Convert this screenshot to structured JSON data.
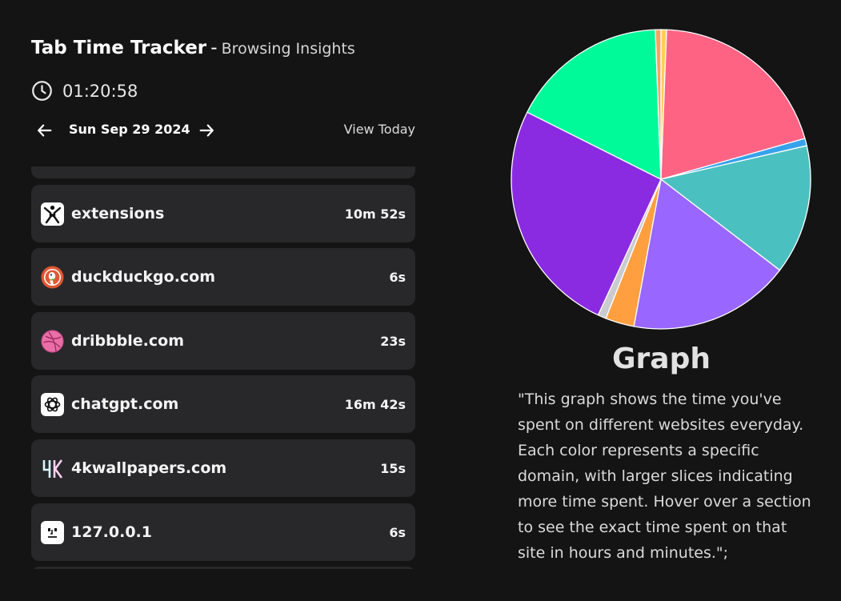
{
  "header": {
    "title": "Tab Time Tracker",
    "separator": "-",
    "subtitle": "Browsing Insights"
  },
  "timer": {
    "icon": "clock-icon",
    "value": "01:20:58"
  },
  "date_nav": {
    "prev_icon": "arrow-left-icon",
    "date": "Sun Sep 29 2024",
    "next_icon": "arrow-right-icon",
    "view_today": "View Today"
  },
  "sites": [
    {
      "domain": "",
      "time": "",
      "icon": ""
    },
    {
      "domain": "extensions",
      "time": "10m 52s",
      "icon": "extensions-icon"
    },
    {
      "domain": "duckduckgo.com",
      "time": "6s",
      "icon": "duckduckgo-icon"
    },
    {
      "domain": "dribbble.com",
      "time": "23s",
      "icon": "dribbble-icon"
    },
    {
      "domain": "chatgpt.com",
      "time": "16m 42s",
      "icon": "chatgpt-icon"
    },
    {
      "domain": "4kwallpapers.com",
      "time": "15s",
      "icon": "4k-icon"
    },
    {
      "domain": "127.0.0.1",
      "time": "6s",
      "icon": "localhost-icon"
    },
    {
      "domain": "",
      "time": "",
      "icon": ""
    }
  ],
  "graph": {
    "title": "Graph",
    "description": "\"This graph shows the time you've spent on different websites everyday. Each color represents a specific domain, with larger slices indicating more time spent. Hover over a section to see the exact time spent on that site in hours and minutes.\";"
  },
  "chart_data": {
    "type": "pie",
    "start_angle_deg": 0,
    "direction": "clockwise",
    "slices": [
      {
        "value": 0.6,
        "color": "#FFCE56"
      },
      {
        "value": 20.0,
        "color": "#FF6384"
      },
      {
        "value": 0.8,
        "color": "#36A2EB"
      },
      {
        "value": 14.0,
        "color": "#4BC0C0"
      },
      {
        "value": 17.5,
        "color": "#9966FF"
      },
      {
        "value": 3.1,
        "color": "#FF9F40"
      },
      {
        "value": 0.9,
        "color": "#C9CBCF"
      },
      {
        "value": 25.5,
        "color": "#8A2BE2"
      },
      {
        "value": 17.0,
        "color": "#00FA9A"
      },
      {
        "value": 0.6,
        "color": "#F4A460"
      }
    ]
  }
}
